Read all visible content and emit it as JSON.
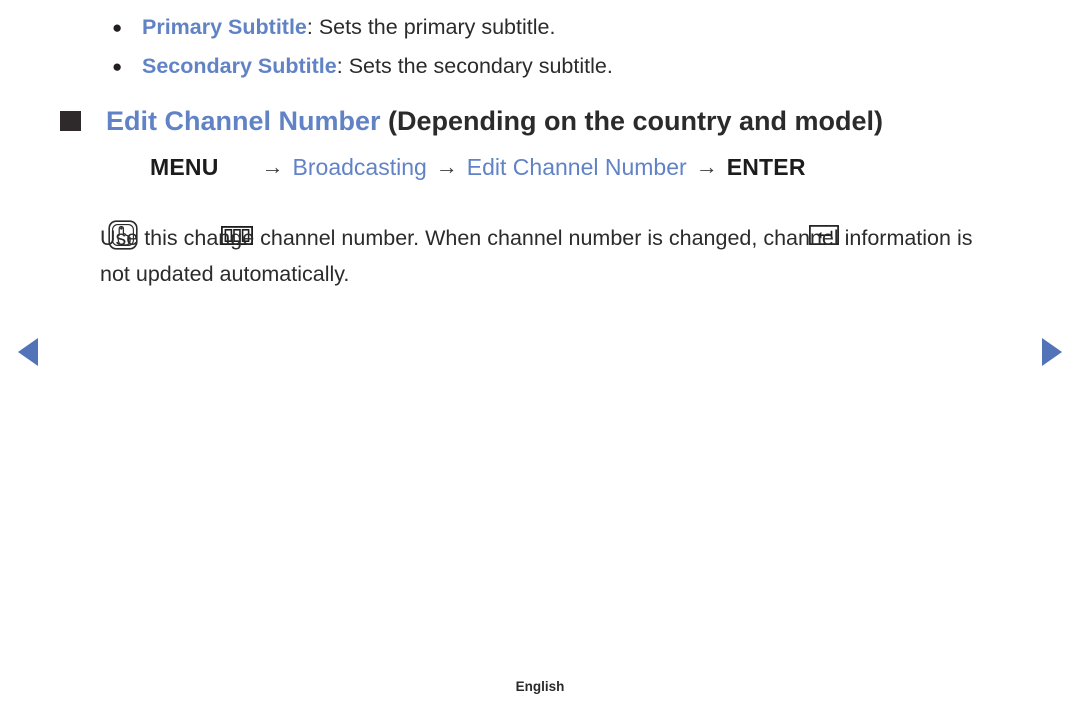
{
  "bullet_list": {
    "marker": "●",
    "items": [
      {
        "label": "Primary Subtitle",
        "rest": ": Sets the primary subtitle."
      },
      {
        "label": "Secondary Subtitle",
        "rest": ": Sets the secondary subtitle."
      }
    ]
  },
  "section": {
    "marker": "■",
    "title_blue": "Edit Channel Number",
    "title_dark": " (Depending on the country and model)"
  },
  "menu_path": {
    "press_icon": "hand-press-icon",
    "menu_label": "MENU",
    "menu_icon": "menu-bars-icon",
    "arrow": "→",
    "step_broadcasting": "Broadcasting",
    "step_edit_channel_number": "Edit Channel Number",
    "enter_label": "ENTER",
    "enter_icon": "enter-return-icon"
  },
  "body": {
    "paragraph": "Use this change channel number. When channel number is changed, channel information is not updated automatically."
  },
  "nav": {
    "prev_icon": "triangle-left-icon",
    "next_icon": "triangle-right-icon"
  },
  "footer": {
    "language": "English"
  },
  "colors": {
    "accent_blue": "#6183c6",
    "nav_blue": "#5273b8",
    "text_dark": "#2b2b2b"
  }
}
